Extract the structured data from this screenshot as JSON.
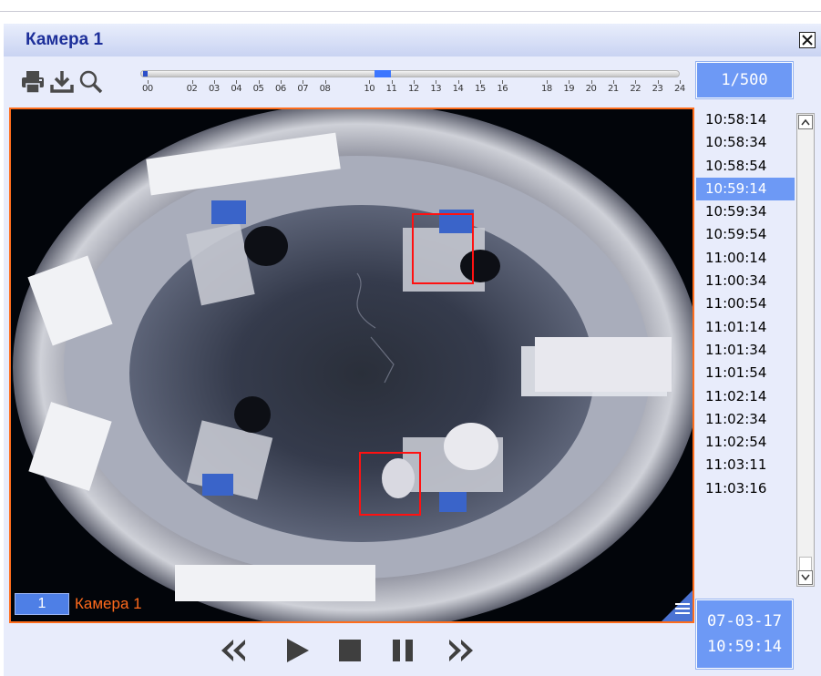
{
  "window": {
    "title": "Камера 1"
  },
  "toolbar": {
    "icons": [
      "print-icon",
      "download-icon",
      "search-icon"
    ],
    "timeline_hours": [
      "00",
      "02",
      "03",
      "04",
      "05",
      "06",
      "07",
      "08",
      "10",
      "11",
      "12",
      "13",
      "14",
      "15",
      "16",
      "18",
      "19",
      "20",
      "21",
      "22",
      "23",
      "24"
    ],
    "frame_counter": "1/500"
  },
  "video": {
    "camera_number": "1",
    "camera_name": "Камера 1",
    "detections_count": 2,
    "accent_color": "#ff6d1c",
    "detection_color": "#ff1111"
  },
  "frame_list": {
    "items": [
      "10:58:14",
      "10:58:34",
      "10:58:54",
      "10:59:14",
      "10:59:34",
      "10:59:54",
      "11:00:14",
      "11:00:34",
      "11:00:54",
      "11:01:14",
      "11:01:34",
      "11:01:54",
      "11:02:14",
      "11:02:34",
      "11:02:54",
      "11:03:11",
      "11:03:16"
    ],
    "selected_index": 3
  },
  "datetime": {
    "date": "07-03-17",
    "time": "10:59:14"
  },
  "playback": {
    "icons": [
      "rewind-icon",
      "play-icon",
      "stop-icon",
      "pause-icon",
      "fast-forward-icon"
    ]
  }
}
